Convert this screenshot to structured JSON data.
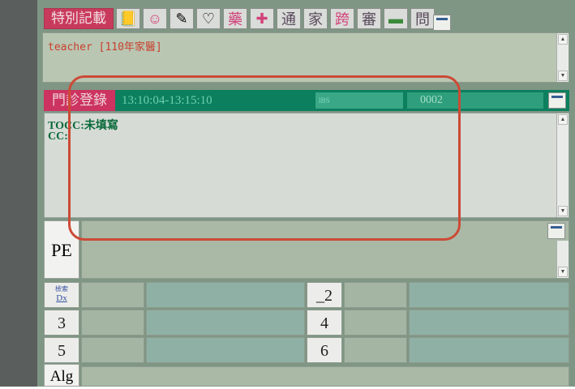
{
  "toolbar": {
    "special_record_label": "特別記載",
    "buttons": [
      {
        "icon": "note-icon",
        "glyph": "📒"
      },
      {
        "icon": "person-icon",
        "glyph": "☺"
      },
      {
        "icon": "pen-icon",
        "glyph": "✎"
      },
      {
        "icon": "stethoscope-icon",
        "glyph": "♡"
      },
      {
        "label": "藥"
      },
      {
        "icon": "medical-cross-icon",
        "glyph": "✚"
      },
      {
        "label": "通"
      },
      {
        "label": "家"
      },
      {
        "label": "跨"
      },
      {
        "label": "審"
      },
      {
        "icon": "book-icon",
        "glyph": "▬"
      },
      {
        "label": "問"
      }
    ]
  },
  "teacher_note": "teacher [110年家醫]",
  "visit": {
    "title": "門診登錄",
    "time_range": "13:10:04-13:15:10",
    "field1": "lBS",
    "field2": "0002"
  },
  "subjective": {
    "line1": "TOCC:未填寫",
    "line2": "CC:"
  },
  "pe_label": "PE",
  "dx": {
    "label_top": "檢索",
    "label_main": "Dx",
    "rows": [
      "_2",
      "3",
      "4",
      "5",
      "6"
    ]
  },
  "alg_label": "Alg",
  "colors": {
    "header_green": "#0b7f5e",
    "title_pink": "#cc3360",
    "highlight_red": "#cc4a36",
    "frame_gray_green": "#7f9684"
  }
}
